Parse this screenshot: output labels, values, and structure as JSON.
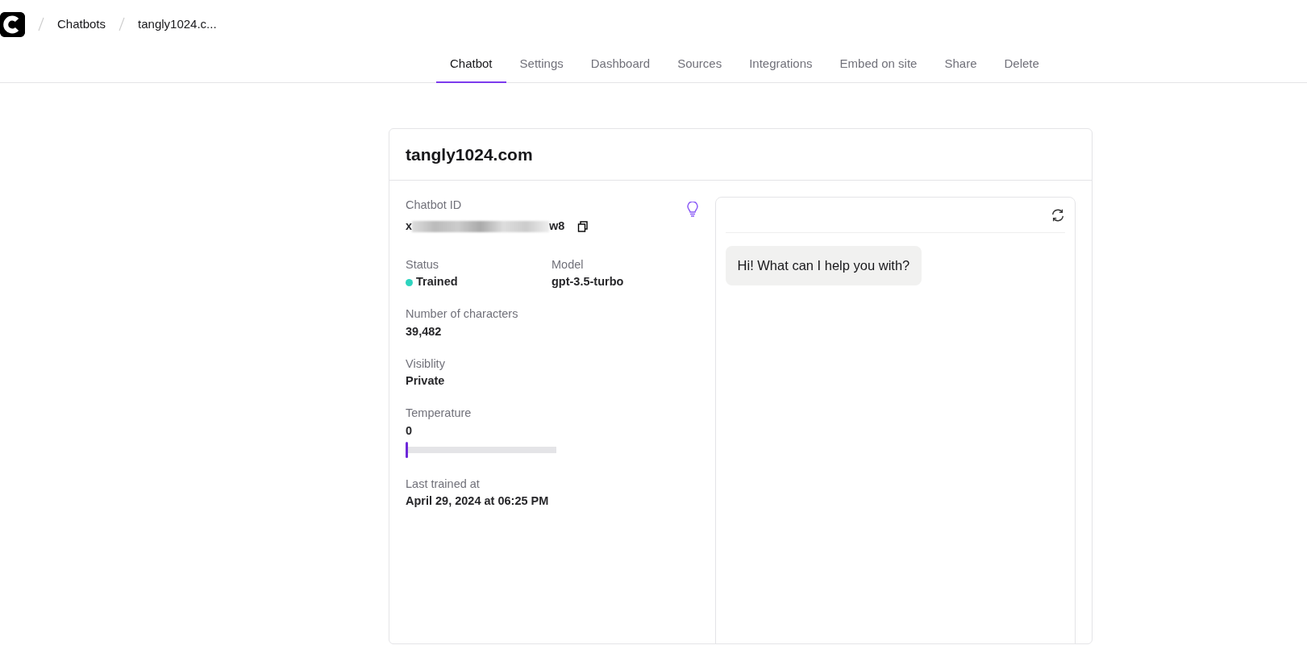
{
  "breadcrumb": [
    "Chatbots",
    "tangly1024.c..."
  ],
  "tabs": [
    {
      "label": "Chatbot",
      "selected": true
    },
    {
      "label": "Settings",
      "selected": false
    },
    {
      "label": "Dashboard",
      "selected": false
    },
    {
      "label": "Sources",
      "selected": false
    },
    {
      "label": "Integrations",
      "selected": false
    },
    {
      "label": "Embed on site",
      "selected": false
    },
    {
      "label": "Share",
      "selected": false
    },
    {
      "label": "Delete",
      "selected": false
    }
  ],
  "card": {
    "title": "tangly1024.com",
    "chatbot_id": {
      "label": "Chatbot ID",
      "value_start": "x",
      "value_end": "w8"
    },
    "status": {
      "label": "Status",
      "value": "Trained",
      "color": "#2dd4bf"
    },
    "model": {
      "label": "Model",
      "value": "gpt-3.5-turbo"
    },
    "characters": {
      "label": "Number of characters",
      "value": "39,482"
    },
    "visibility": {
      "label": "Visiblity",
      "value": "Private"
    },
    "temperature": {
      "label": "Temperature",
      "value": "0",
      "level": 0
    },
    "last_trained": {
      "label": "Last trained at",
      "value": "April 29, 2024 at 06:25 PM"
    }
  },
  "chat": {
    "messages": [
      {
        "text": "Hi! What can I help you with?"
      }
    ]
  }
}
